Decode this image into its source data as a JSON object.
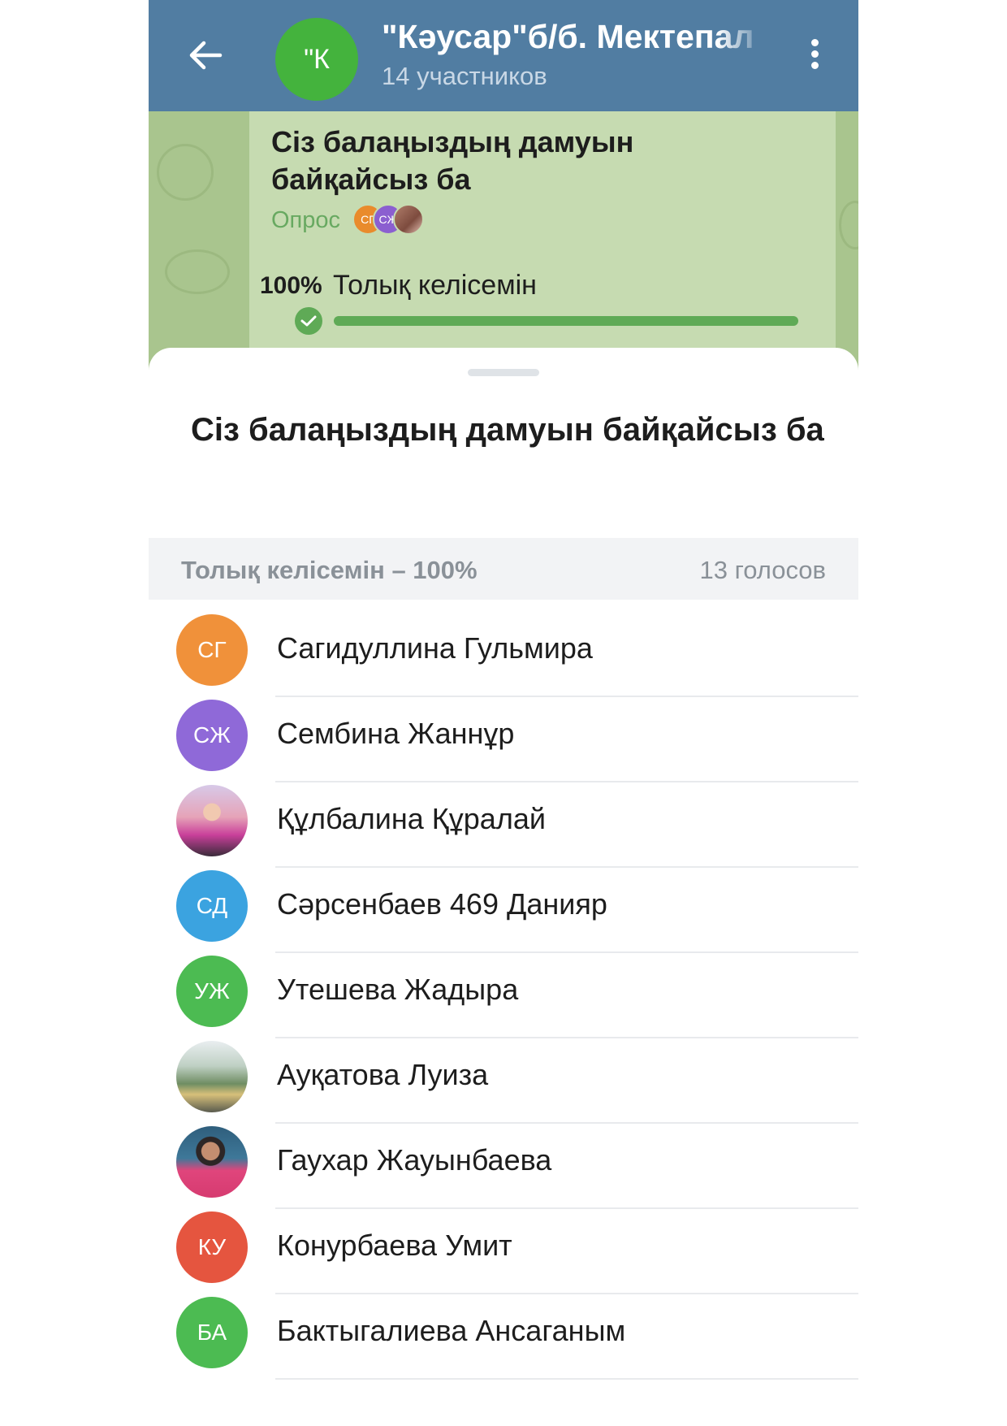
{
  "header": {
    "avatar_text": "\"К",
    "title": "\"Кәусар\"б/б. Мектепал",
    "subtitle": "14 участников"
  },
  "poll": {
    "question": "Сіз балаңыздың дамуын байқайсыз ба",
    "type_label": "Опрос",
    "mini_avatars": [
      "СГ",
      "СЖ"
    ],
    "option_percent": "100%",
    "option_text": "Толық келісемін",
    "option_fill": 1.0
  },
  "sheet": {
    "title": "Сіз балаңыздың дамуын байқайсыз ба",
    "section_label": "Толық келісемін – 100%",
    "section_votes": "13 голосов",
    "voters": [
      {
        "initials": "СГ",
        "name": "Сагидуллина Гульмира",
        "color": "#f0913a"
      },
      {
        "initials": "СЖ",
        "name": "Сембина Жаннұр",
        "color": "#8f69d8"
      },
      {
        "initials": "",
        "name": "Құлбалина Құралай",
        "photo": true
      },
      {
        "initials": "СД",
        "name": "Сәрсенбаев 469 Данияр",
        "color": "#3ba3e0"
      },
      {
        "initials": "УЖ",
        "name": "Утешева Жадыра",
        "color": "#4cbb52"
      },
      {
        "initials": "",
        "name": "Ауқатова Луиза",
        "photo": true
      },
      {
        "initials": "",
        "name": "Гаухар Жауынбаева",
        "photo": true
      },
      {
        "initials": "КУ",
        "name": "Конурбаева Умит",
        "color": "#e5553f"
      },
      {
        "initials": "БА",
        "name": "Бактыгалиева Ансаганым",
        "color": "#4cbb52"
      }
    ]
  },
  "colors": {
    "header_bg": "#517da2",
    "poll_accent": "#5faa56",
    "chat_bg": "#a9c58e"
  }
}
